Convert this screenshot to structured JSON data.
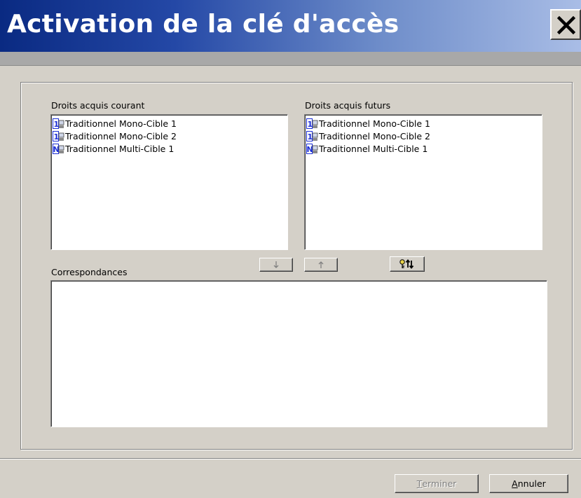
{
  "window": {
    "title": "Activation de la clé d'accès",
    "close_glyph": "X"
  },
  "current_rights": {
    "label": "Droits acquis courant",
    "items": [
      {
        "label": "Traditionnel Mono-Cible 1",
        "icon": "mono-target-icon"
      },
      {
        "label": "Traditionnel Mono-Cible 2",
        "icon": "mono-target-icon"
      },
      {
        "label": "Traditionnel Multi-Cible 1",
        "icon": "multi-target-icon"
      }
    ]
  },
  "future_rights": {
    "label": "Droits acquis futurs",
    "items": [
      {
        "label": "Traditionnel Mono-Cible 1",
        "icon": "mono-target-icon"
      },
      {
        "label": "Traditionnel Mono-Cible 2",
        "icon": "mono-target-icon"
      },
      {
        "label": "Traditionnel Multi-Cible 1",
        "icon": "multi-target-icon"
      }
    ]
  },
  "buttons": {
    "move_down_icon": "arrow-down-icon",
    "move_up_icon": "arrow-up-icon",
    "auto_map_icon": "key-swap-icon",
    "finish_mnemonic": "T",
    "finish_rest": "erminer",
    "cancel_mnemonic": "A",
    "cancel_rest": "nnuler"
  },
  "mappings": {
    "label": "Correspondances",
    "items": []
  },
  "colors": {
    "title_gradient_start": "#0a2a82",
    "title_gradient_end": "#a9bde6",
    "dialog_bg": "#d4d0c8",
    "icon_blue": "#1c2fd6"
  }
}
